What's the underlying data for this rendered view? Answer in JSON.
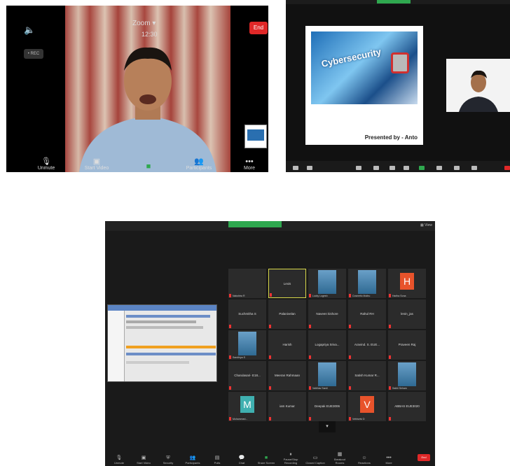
{
  "shot1": {
    "title": "Zoom ▾",
    "time": "12:30",
    "end_label": "End",
    "rec_label": "• REC",
    "toolbar": [
      {
        "label": "Unmute",
        "icon": "mic-muted-icon"
      },
      {
        "label": "Start Video",
        "icon": "video-off-icon"
      },
      {
        "label": "Share",
        "icon": "share-icon"
      },
      {
        "label": "Participants",
        "icon": "participants-icon"
      },
      {
        "label": "More",
        "icon": "more-icon"
      }
    ]
  },
  "shot2": {
    "slide_heading": "Cybersecurity",
    "presented_by": "Presented by - Anto"
  },
  "shot3": {
    "view_label": "▦ View",
    "tiles": [
      {
        "name": "",
        "label": "Nakshtra R",
        "kind": "blank"
      },
      {
        "name": "Lexis",
        "label": "",
        "kind": "active"
      },
      {
        "name": "",
        "label": "Lucky Logesh",
        "kind": "photo"
      },
      {
        "name": "",
        "label": "Cosmetic Muthu",
        "kind": "photo"
      },
      {
        "name": "",
        "label": "Hariha Sona",
        "kind": "avatar",
        "letter": "H",
        "color": "#e8532b"
      },
      {
        "name": "Suchmitha S",
        "label": "",
        "kind": "name"
      },
      {
        "name": "Palanivelan",
        "label": "",
        "kind": "name"
      },
      {
        "name": "Naveen kishore",
        "label": "",
        "kind": "name"
      },
      {
        "name": "Rahul RH",
        "label": "",
        "kind": "name"
      },
      {
        "name": "lenin_jas",
        "label": "",
        "kind": "name"
      },
      {
        "name": "",
        "label": "Sandhiya S",
        "kind": "photo"
      },
      {
        "name": "Harish",
        "label": "",
        "kind": "name"
      },
      {
        "name": "Logapriya Sriva...",
        "label": "",
        "kind": "name"
      },
      {
        "name": "Aravind. S. EUE...",
        "label": "",
        "kind": "name"
      },
      {
        "name": "Praveen Raj",
        "label": "",
        "kind": "name"
      },
      {
        "name": "Charulasari- E18...",
        "label": "",
        "kind": "name"
      },
      {
        "name": "Meeran Rahmaan",
        "label": "",
        "kind": "name"
      },
      {
        "name": "",
        "label": "Vaibhav Sardi",
        "kind": "photo"
      },
      {
        "name": "Satish Kumar R...",
        "label": "",
        "kind": "name"
      },
      {
        "name": "",
        "label": "Sakhi Seham",
        "kind": "photo"
      },
      {
        "name": "",
        "label": "Mohammed...",
        "kind": "avatar",
        "letter": "M",
        "color": "#3fb0b0"
      },
      {
        "name": "iam Kumar",
        "label": "",
        "kind": "name"
      },
      {
        "name": "Deepak EUE3006",
        "label": "",
        "kind": "name"
      },
      {
        "name": "",
        "label": "Vetriselvi D",
        "kind": "avatar",
        "letter": "V",
        "color": "#e8532b"
      },
      {
        "name": "ABBAS EUE3020",
        "label": "",
        "kind": "name"
      }
    ],
    "down_label": "▾",
    "end_label": "End",
    "toolbar": [
      "Unmute",
      "Start Video",
      "Security",
      "Participants",
      "Polls",
      "Chat",
      "Share Screen",
      "Pause/Stop Recording",
      "Closed Caption",
      "Breakout Rooms",
      "Reactions",
      "More"
    ]
  }
}
